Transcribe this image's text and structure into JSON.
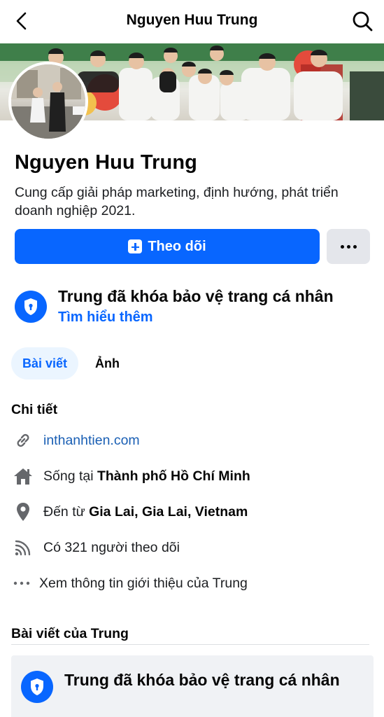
{
  "header": {
    "title": "Nguyen Huu Trung"
  },
  "profile": {
    "name": "Nguyen Huu Trung",
    "bio": "Cung cấp giải pháp marketing, định hướng, phát triển doanh nghiệp 2021.",
    "follow_label": "Theo dõi"
  },
  "privacy": {
    "title": "Trung đã khóa bảo vệ trang cá nhân",
    "link": "Tìm hiểu thêm"
  },
  "tabs": [
    {
      "label": "Bài viết",
      "active": true
    },
    {
      "label": "Ảnh",
      "active": false
    }
  ],
  "details": {
    "heading": "Chi tiết",
    "website": "inthanhtien.com",
    "lives_prefix": "Sống tại ",
    "lives_place": "Thành phố Hồ Chí Minh",
    "from_prefix": "Đến từ ",
    "from_place": "Gia Lai, Gia Lai, Vietnam",
    "followers": "Có 321 người theo dõi",
    "see_about": "Xem thông tin giới thiệu của Trung"
  },
  "posts": {
    "heading": "Bài viết của Trung",
    "locked_title": "Trung đã khóa bảo vệ trang cá nhân"
  },
  "colors": {
    "accent": "#0866ff",
    "secondary_button": "#e4e6eb",
    "card_background": "#f0f2f5"
  },
  "icons": [
    "back-arrow-icon",
    "search-icon",
    "follow-plus-icon",
    "more-dots-icon",
    "shield-lock-icon",
    "link-icon",
    "home-icon",
    "location-pin-icon",
    "rss-icon",
    "ellipsis-icon"
  ]
}
